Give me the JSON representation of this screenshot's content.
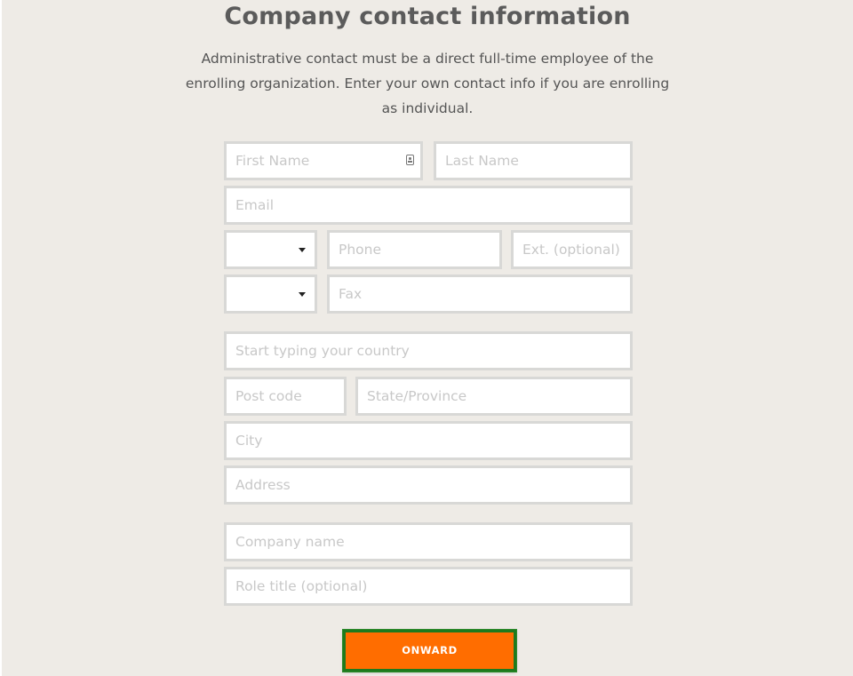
{
  "page": {
    "title": "Company contact information",
    "description": "Administrative contact must be a direct full-time employee of the enrolling organization. Enter your own contact info if you are enrolling as individual."
  },
  "form": {
    "first_name": {
      "placeholder": "First Name",
      "value": ""
    },
    "last_name": {
      "placeholder": "Last Name",
      "value": ""
    },
    "email": {
      "placeholder": "Email",
      "value": ""
    },
    "phone_country_code": {
      "value": ""
    },
    "phone": {
      "placeholder": "Phone",
      "value": ""
    },
    "phone_ext": {
      "placeholder": "Ext. (optional)",
      "value": ""
    },
    "fax_country_code": {
      "value": ""
    },
    "fax": {
      "placeholder": "Fax",
      "value": ""
    },
    "country": {
      "placeholder": "Start typing your country",
      "value": ""
    },
    "post_code": {
      "placeholder": "Post code",
      "value": ""
    },
    "state_province": {
      "placeholder": "State/Province",
      "value": ""
    },
    "city": {
      "placeholder": "City",
      "value": ""
    },
    "address": {
      "placeholder": "Address",
      "value": ""
    },
    "company_name": {
      "placeholder": "Company name",
      "value": ""
    },
    "role_title": {
      "placeholder": "Role title (optional)",
      "value": ""
    }
  },
  "buttons": {
    "submit_label": "ONWARD"
  },
  "icons": {
    "first_name_field_icon": "contact-card-icon",
    "select_arrow": "caret-down-icon"
  },
  "colors": {
    "background": "#eeebe6",
    "accent_button": "#ff6d00",
    "button_focus_border": "#1e7a1e",
    "input_border": "#d8d8d6",
    "placeholder_text": "#c8c8c8",
    "heading_text": "#5b5b5b"
  }
}
